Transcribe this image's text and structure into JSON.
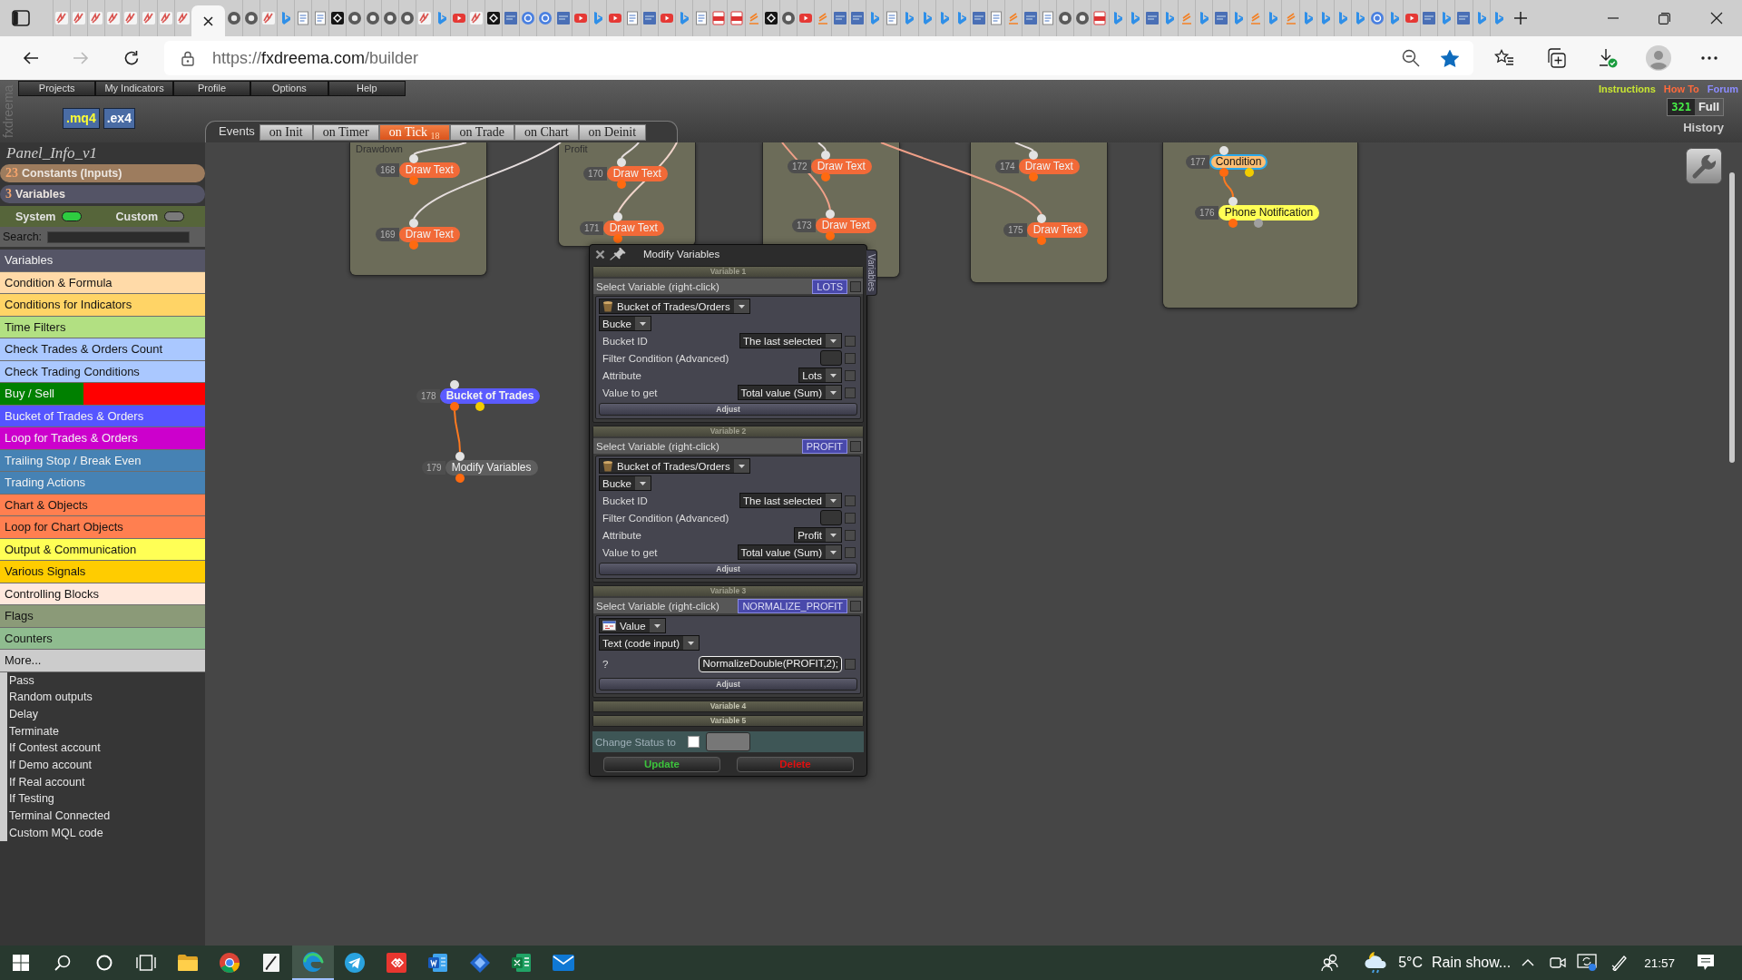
{
  "browser": {
    "tabs": [
      {
        "selected": false
      },
      {
        "selected": false
      },
      {
        "selected": false
      },
      {
        "selected": false
      },
      {
        "selected": false
      },
      {
        "selected": false
      },
      {
        "selected": false
      },
      {
        "selected": false
      },
      {
        "selected": true
      },
      {
        "selected": false
      },
      {
        "selected": false
      },
      {
        "selected": false
      },
      {
        "selected": false
      },
      {
        "selected": false
      },
      {
        "selected": false
      },
      {
        "selected": false
      },
      {
        "selected": false
      },
      {
        "selected": false
      },
      {
        "selected": false
      },
      {
        "selected": false
      },
      {
        "selected": false
      },
      {
        "selected": false
      },
      {
        "selected": false
      },
      {
        "selected": false
      },
      {
        "selected": false
      },
      {
        "selected": false
      },
      {
        "selected": false
      },
      {
        "selected": false
      },
      {
        "selected": false
      },
      {
        "selected": false
      },
      {
        "selected": false
      },
      {
        "selected": false
      },
      {
        "selected": false
      },
      {
        "selected": false
      },
      {
        "selected": false
      },
      {
        "selected": false
      },
      {
        "selected": false
      },
      {
        "selected": false
      },
      {
        "selected": false
      },
      {
        "selected": false
      },
      {
        "selected": false
      },
      {
        "selected": false
      },
      {
        "selected": false
      },
      {
        "selected": false
      },
      {
        "selected": false
      },
      {
        "selected": false
      },
      {
        "selected": false
      },
      {
        "selected": false
      },
      {
        "selected": false
      },
      {
        "selected": false
      },
      {
        "selected": false
      },
      {
        "selected": false
      },
      {
        "selected": false
      },
      {
        "selected": false
      },
      {
        "selected": false
      },
      {
        "selected": false
      },
      {
        "selected": false
      },
      {
        "selected": false
      },
      {
        "selected": false
      },
      {
        "selected": false
      },
      {
        "selected": false
      },
      {
        "selected": false
      },
      {
        "selected": false
      },
      {
        "selected": false
      },
      {
        "selected": false
      },
      {
        "selected": false
      },
      {
        "selected": false
      },
      {
        "selected": false
      },
      {
        "selected": false
      },
      {
        "selected": false
      },
      {
        "selected": false
      },
      {
        "selected": false
      },
      {
        "selected": false
      },
      {
        "selected": false
      },
      {
        "selected": false
      },
      {
        "selected": false
      },
      {
        "selected": false
      },
      {
        "selected": false
      },
      {
        "selected": false
      },
      {
        "selected": false
      },
      {
        "selected": false
      },
      {
        "selected": false
      },
      {
        "selected": false
      }
    ],
    "back": {
      "disabled": false
    },
    "forward": {
      "disabled": true
    },
    "address": {
      "scheme": "https://",
      "host": "fxdreema.com",
      "path": "/builder"
    },
    "favorite": {
      "on": true
    }
  },
  "app": {
    "brand": "fxdreema",
    "menu": [
      "Projects",
      "My Indicators",
      "Profile",
      "Options",
      "Help"
    ],
    "export_buttons": [
      {
        "label": ".mq4",
        "color": "#ffff33"
      },
      {
        "label": ".ex4",
        "color": "#ffffff"
      }
    ],
    "links": [
      {
        "label": "Instructions",
        "color": "#c8e632"
      },
      {
        "label": "How To",
        "color": "#ff6a3c"
      },
      {
        "label": "Forum",
        "color": "#8c8cff"
      }
    ],
    "counter": "321",
    "full_button": "Full",
    "history": "History",
    "events": {
      "label": "Events",
      "tabs": [
        {
          "label": "on Init",
          "selected": false
        },
        {
          "label": "on Timer",
          "selected": false
        },
        {
          "label": "on Tick",
          "count": "18",
          "selected": true
        },
        {
          "label": "on Trade",
          "selected": false
        },
        {
          "label": "on Chart",
          "selected": false
        },
        {
          "label": "on Deinit",
          "selected": false
        }
      ]
    }
  },
  "sidebar": {
    "project_name": "Panel_Info_v1",
    "constants": {
      "count": "23",
      "label": "Constants (Inputs)"
    },
    "variables": {
      "count": "3",
      "label": "Variables"
    },
    "toggles": [
      {
        "label": "System",
        "on": true
      },
      {
        "label": "Custom",
        "on": false
      }
    ],
    "search": {
      "label": "Search:"
    },
    "categories": [
      {
        "label": "Variables",
        "color": "#555566"
      },
      {
        "label": "Condition & Formula",
        "color": "#ffdaa8"
      },
      {
        "label": "Conditions for Indicators",
        "color": "#ffd466"
      },
      {
        "label": "Time Filters",
        "color": "#b2e082"
      },
      {
        "label": "Check Trades & Orders Count",
        "color": "#aac8ff"
      },
      {
        "label": "Check Trading Conditions",
        "color": "#aac8ff"
      },
      {
        "label": "Buy / Sell",
        "color": "#008000",
        "right_band": {
          "color": "#ff0000"
        }
      },
      {
        "label": "Bucket of Trades & Orders",
        "color": "#5555ff"
      },
      {
        "label": "Loop for Trades & Orders",
        "color": "#cc00cc"
      },
      {
        "label": "Trailing Stop / Break Even",
        "color": "#4682b4"
      },
      {
        "label": "Trading Actions",
        "color": "#4682b4"
      },
      {
        "label": "Chart & Objects",
        "color": "#ff7f50"
      },
      {
        "label": "Loop for Chart Objects",
        "color": "#ff7f50"
      },
      {
        "label": "Output & Communication",
        "color": "#ffff55"
      },
      {
        "label": "Various Signals",
        "color": "#ffcc00"
      },
      {
        "label": "Controlling Blocks",
        "color": "#ffe8dc"
      },
      {
        "label": "Flags",
        "color": "#8b9a78"
      },
      {
        "label": "Counters",
        "color": "#8fbc8f"
      },
      {
        "label": "More...",
        "color": "#cccccc"
      }
    ],
    "more_items": [
      "Pass",
      "Random outputs",
      "Delay",
      "Terminate",
      "If Contest account",
      "If Demo account",
      "If Real account",
      "If Testing",
      "Terminal Connected",
      "Custom MQL code"
    ]
  },
  "canvas": {
    "groups": [
      {
        "title": "Drawdown",
        "blocks": [
          {
            "number": "168",
            "label": "Draw Text",
            "kind": "action",
            "color": "#f26a38",
            "selected": false
          },
          {
            "number": "169",
            "label": "Draw Text",
            "kind": "action",
            "color": "#f26a38",
            "selected": false
          }
        ]
      },
      {
        "title": "Profit",
        "blocks": [
          {
            "number": "170",
            "label": "Draw Text",
            "kind": "action",
            "color": "#f26a38",
            "selected": false
          },
          {
            "number": "171",
            "label": "Draw Text",
            "kind": "action",
            "color": "#f26a38",
            "selected": false
          }
        ]
      },
      {
        "blocks": [
          {
            "number": "172",
            "label": "Draw Text",
            "kind": "action",
            "color": "#f26a38",
            "selected": false
          },
          {
            "number": "173",
            "label": "Draw Text",
            "kind": "action",
            "color": "#f26a38",
            "selected": false
          }
        ]
      },
      {
        "blocks": [
          {
            "number": "174",
            "label": "Draw Text",
            "kind": "action",
            "color": "#f26a38",
            "selected": false
          },
          {
            "number": "175",
            "label": "Draw Text",
            "kind": "action",
            "color": "#f26a38",
            "selected": false
          }
        ]
      },
      {
        "blocks": [
          {
            "number": "177",
            "label": "Condition",
            "kind": "condition",
            "color": "#ffbe73",
            "selected": true
          },
          {
            "number": "176",
            "label": "Phone Notification",
            "kind": "notification",
            "color": "#ffff55",
            "selected": false
          }
        ]
      }
    ],
    "blocks": [
      {
        "number": "178",
        "label": "Bucket of Trades",
        "kind": "bucket",
        "color": "#5b5bff",
        "selected": false
      },
      {
        "number": "179",
        "label": "Modify Variables",
        "kind": "action",
        "color": "#5e5e5e",
        "selected": false
      }
    ]
  },
  "dialog": {
    "title": "Modify Variables",
    "side_tab": "Variables",
    "variables": [
      {
        "header": "Variable 1",
        "expanded": true,
        "select_label": "Select Variable (right-click)",
        "name": "LOTS",
        "checked": false,
        "kind": "bucket",
        "type": "Bucket of Trades/Orders",
        "subtype": "Bucke",
        "fields": [
          {
            "label": "Bucket ID",
            "kind": "select",
            "value": "The last selected",
            "checked": false
          },
          {
            "label": "Filter Condition (Advanced)",
            "kind": "box",
            "checked": false
          },
          {
            "label": "Attribute",
            "kind": "select",
            "value": "Lots",
            "checked": false
          },
          {
            "label": "Value to get",
            "kind": "select",
            "value": "Total value (Sum)",
            "checked": false
          }
        ],
        "adjust": "Adjust"
      },
      {
        "header": "Variable 2",
        "expanded": true,
        "select_label": "Select Variable (right-click)",
        "name": "PROFIT",
        "checked": false,
        "kind": "bucket",
        "type": "Bucket of Trades/Orders",
        "subtype": "Bucke",
        "fields": [
          {
            "label": "Bucket ID",
            "kind": "select",
            "value": "The last selected",
            "checked": false
          },
          {
            "label": "Filter Condition (Advanced)",
            "kind": "box",
            "checked": false
          },
          {
            "label": "Attribute",
            "kind": "select",
            "value": "Profit",
            "checked": false
          },
          {
            "label": "Value to get",
            "kind": "select",
            "value": "Total value (Sum)",
            "checked": false
          }
        ],
        "adjust": "Adjust"
      },
      {
        "header": "Variable 3",
        "expanded": true,
        "select_label": "Select Variable (right-click)",
        "name": "NORMALIZE_PROFIT",
        "checked": false,
        "kind": "value",
        "type": "Value",
        "subtype": "Text (code input)",
        "fields": [
          {
            "label": "?",
            "kind": "input",
            "value": "NormalizeDouble(PROFIT,2);",
            "checked": false
          }
        ],
        "adjust": "Adjust"
      },
      {
        "header": "Variable 4",
        "expanded": false
      },
      {
        "header": "Variable 5",
        "expanded": false
      }
    ],
    "change_status": {
      "label": "Change Status to",
      "checked": false
    },
    "buttons": [
      {
        "label": "Update",
        "kind": "update"
      },
      {
        "label": "Delete",
        "kind": "delete"
      }
    ]
  },
  "taskbar": {
    "apps": [
      {
        "selected": false
      },
      {
        "selected": false
      },
      {
        "selected": false
      },
      {
        "selected": true
      },
      {
        "selected": false
      },
      {
        "selected": false
      },
      {
        "selected": false
      },
      {
        "selected": false
      },
      {
        "selected": false
      },
      {
        "selected": false
      }
    ],
    "weather": {
      "temp": "5°C",
      "text": "Rain show..."
    },
    "time": "21:57"
  }
}
